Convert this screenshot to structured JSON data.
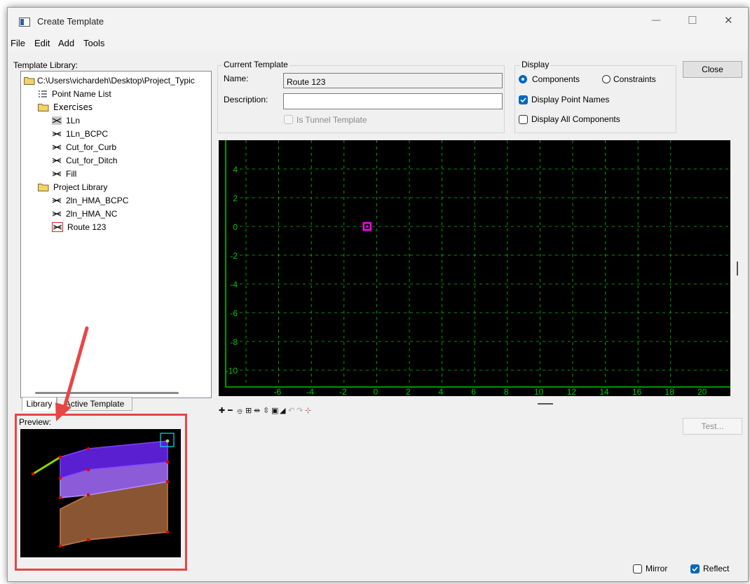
{
  "window": {
    "title": "Create Template",
    "controls": {
      "minimize": "—",
      "maximize": "☐",
      "close": "✕"
    }
  },
  "menu": [
    "File",
    "Edit",
    "Add",
    "Tools"
  ],
  "library": {
    "label": "Template Library:",
    "root_path": "C:\\Users\\vichardeh\\Desktop\\Project_Typic",
    "point_name_list": "Point Name List",
    "exercises_folder": "Exercises",
    "exercises": [
      "1Ln",
      "1Ln_BCPC",
      "Cut_for_Curb",
      "Cut_for_Ditch",
      "Fill"
    ],
    "project_folder": "Project Library",
    "project_items": [
      "2ln_HMA_BCPC",
      "2ln_HMA_NC",
      "Route 123"
    ]
  },
  "tabs": {
    "library": "Library",
    "active_template": "Active Template"
  },
  "preview": {
    "label": "Preview:"
  },
  "current_template": {
    "group_label": "Current Template",
    "name_label": "Name:",
    "name_value": "Route 123",
    "description_label": "Description:",
    "description_value": "",
    "tunnel_label": "Is Tunnel Template"
  },
  "display": {
    "group_label": "Display",
    "components_label": "Components",
    "constraints_label": "Constraints",
    "selected": "Components",
    "display_point_names_label": "Display Point Names",
    "display_point_names_checked": true,
    "display_all_components_label": "Display All Components",
    "display_all_components_checked": false
  },
  "buttons": {
    "close": "Close",
    "test": "Test..."
  },
  "options": {
    "mirror_label": "Mirror",
    "mirror_checked": false,
    "reflect_label": "Reflect",
    "reflect_checked": true
  },
  "grid": {
    "background": "#000000",
    "grid_color": "#00c800",
    "y_ticks": [
      "4",
      "2",
      "0",
      "-2",
      "-4",
      "-6",
      "-8",
      "-10"
    ],
    "x_ticks": [
      "-6",
      "-4",
      "-2",
      "0",
      "2",
      "4",
      "6",
      "8",
      "10",
      "12",
      "14",
      "16",
      "18",
      "20"
    ]
  },
  "colors": {
    "annotation_red": "#e84545",
    "origin_marker": "#ff00ff",
    "accent_blue": "#0067c0"
  }
}
